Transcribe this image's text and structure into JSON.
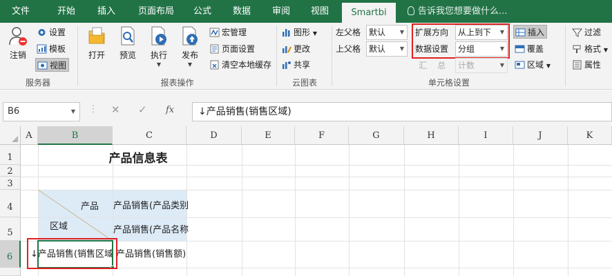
{
  "tabs": [
    {
      "label": "文件"
    },
    {
      "label": "开始"
    },
    {
      "label": "插入"
    },
    {
      "label": "页面布局"
    },
    {
      "label": "公式"
    },
    {
      "label": "数据"
    },
    {
      "label": "审阅"
    },
    {
      "label": "视图"
    },
    {
      "label": "Smartbi",
      "active": true
    }
  ],
  "tell_me": "告诉我您想要做什么...",
  "ribbon": {
    "server": {
      "group_label": "服务器",
      "logout": "注销",
      "settings": "设置",
      "template": "模板",
      "view": "视图"
    },
    "report_ops": {
      "group_label": "报表操作",
      "open": "打开",
      "preview": "预览",
      "execute": "执行",
      "publish": "发布",
      "macro_mgmt": "宏管理",
      "page_setup": "页面设置",
      "clear_cache": "清空本地缓存"
    },
    "cloud_chart": {
      "group_label": "云图表",
      "chart": "图形",
      "update": "更改",
      "share": "共享"
    },
    "cell_settings": {
      "group_label": "单元格设置",
      "left_parent_label": "左父格",
      "left_parent_value": "默认",
      "top_parent_label": "上父格",
      "top_parent_value": "默认",
      "expand_dir_label": "扩展方向",
      "expand_dir_value": "从上到下",
      "data_setting_label": "数据设置",
      "data_setting_value": "分组",
      "summary_label": "汇    总",
      "summary_value": "计数",
      "insert": "插入",
      "overwrite": "覆盖",
      "region": "区域"
    },
    "misc": {
      "filter": "过滤",
      "format": "格式",
      "property": "属性"
    }
  },
  "formula_bar": {
    "name_box": "B6",
    "cancel_icon": "✕",
    "enter_icon": "✓",
    "fx": "fx",
    "content": "↓产品销售(销售区域)"
  },
  "sheet": {
    "columns": [
      "A",
      "B",
      "C",
      "D",
      "E",
      "F",
      "G",
      "H",
      "I",
      "J",
      "K"
    ],
    "rows": [
      "1",
      "2",
      "3",
      "4",
      "5",
      "6"
    ],
    "title": "产品信息表",
    "b4_header": "产品",
    "b5_header": "区域",
    "c4": "产品销售(产品类别)",
    "c5": "产品销售(产品名称)",
    "b6": "↓产品销售(销售区域)",
    "c6": "产品销售(销售额)"
  },
  "colors": {
    "accent": "#217346",
    "highlight_red": "#e02020",
    "header_fill": "#ddebf7"
  }
}
